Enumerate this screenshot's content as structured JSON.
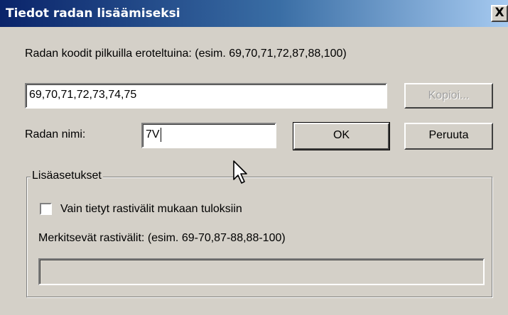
{
  "window": {
    "title": "Tiedot radan lisäämiseksi",
    "close_label": "X"
  },
  "codes": {
    "label": "Radan koodit pilkuilla eroteltuina: (esim. 69,70,71,72,87,88,100)",
    "value": "69,70,71,72,73,74,75",
    "copy_button": "Kopioi..."
  },
  "name": {
    "label": "Radan nimi:",
    "value": "7V",
    "ok_button": "OK",
    "cancel_button": "Peruuta"
  },
  "advanced": {
    "legend": "Lisäasetukset",
    "checkbox_label": "Vain tietyt rastivälit mukaan tuloksiin",
    "checkbox_checked": false,
    "legs_label": "Merkitsevät rastivälit: (esim. 69-70,87-88,88-100)",
    "legs_value": ""
  }
}
